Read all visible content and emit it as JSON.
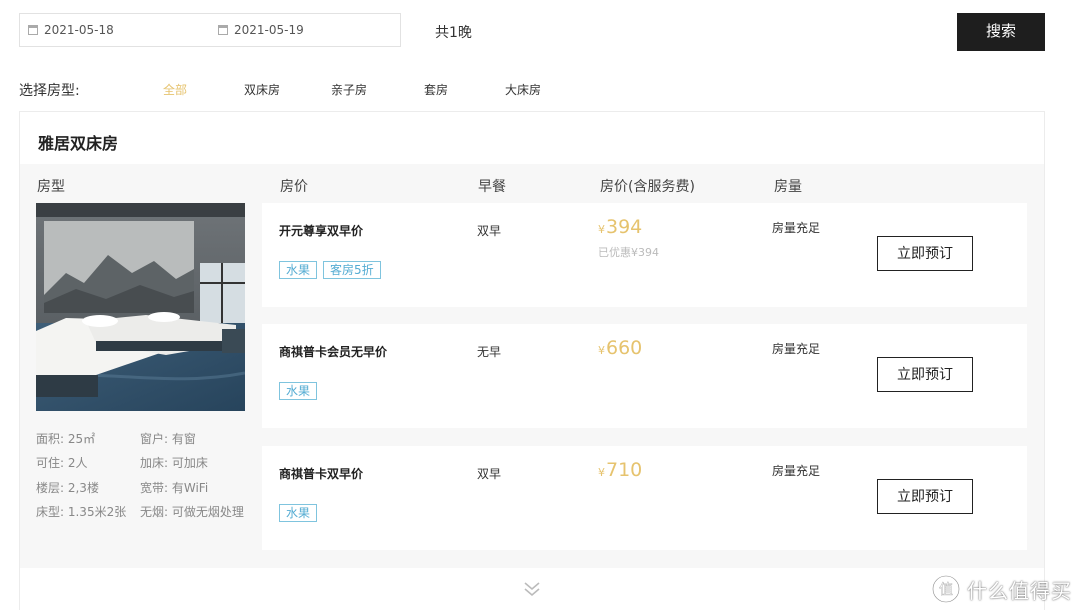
{
  "search": {
    "checkin": "2021-05-18",
    "checkout": "2021-05-19",
    "nights": "共1晚",
    "search_label": "搜索"
  },
  "filter": {
    "label": "选择房型:",
    "tabs": [
      "全部",
      "双床房",
      "亲子房",
      "套房",
      "大床房"
    ],
    "active_tab": "全部",
    "active_color": "#e6c36e"
  },
  "room": {
    "title": "雅居双床房",
    "columns": [
      "房型",
      "房价",
      "早餐",
      "房价(含服务费)",
      "房量"
    ],
    "info": [
      [
        "面积: 25㎡",
        "窗户: 有窗"
      ],
      [
        "可住: 2人",
        "加床: 可加床"
      ],
      [
        "楼层: 2,3楼",
        "宽带: 有WiFi"
      ],
      [
        "床型: 1.35米2张",
        "无烟: 可做无烟处理"
      ]
    ],
    "rates": [
      {
        "name": "开元尊享双早价",
        "tags": [
          "水果",
          "客房5折"
        ],
        "breakfast": "双早",
        "currency": "¥",
        "price": "394",
        "discount": "已优惠¥394",
        "availability": "房量充足",
        "book_label": "立即预订"
      },
      {
        "name": "商祺普卡会员无早价",
        "tags": [
          "水果"
        ],
        "breakfast": "无早",
        "currency": "¥",
        "price": "660",
        "discount": "",
        "availability": "房量充足",
        "book_label": "立即预订"
      },
      {
        "name": "商祺普卡双早价",
        "tags": [
          "水果"
        ],
        "breakfast": "双早",
        "currency": "¥",
        "price": "710",
        "discount": "",
        "availability": "房量充足",
        "book_label": "立即预订"
      }
    ],
    "expand_icon": "double-chevron-down-icon"
  },
  "colors": {
    "accent_gold": "#e6c36e",
    "tag_blue": "#55acd3",
    "search_button_bg": "#1e1e1e"
  },
  "watermark": {
    "logo_char": "值",
    "text": "什么值得买"
  }
}
